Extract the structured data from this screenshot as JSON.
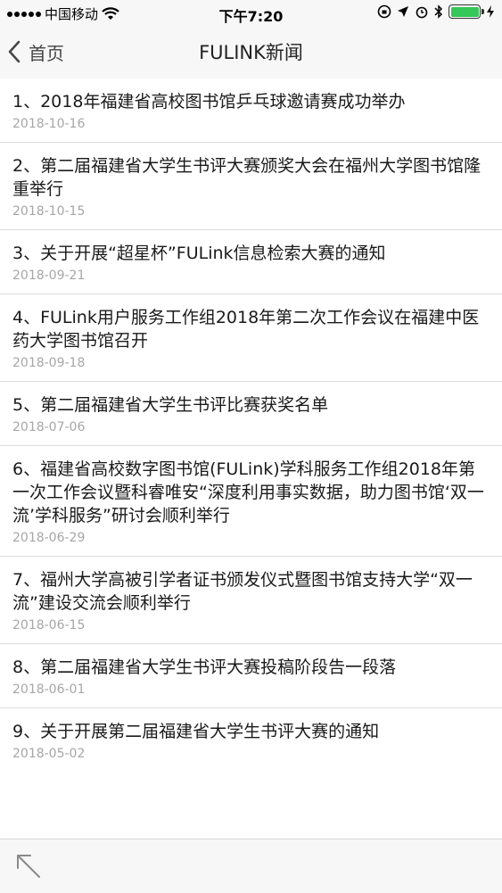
{
  "status_bar": {
    "carrier": "中国移动",
    "time": "下午7:20",
    "battery_color": "#35c759"
  },
  "nav": {
    "back_label": "首页",
    "title": "FULINK新闻"
  },
  "news": [
    {
      "title": "1、2018年福建省高校图书馆乒乓球邀请赛成功举办",
      "date": "2018-10-16"
    },
    {
      "title": "2、第二届福建省大学生书评大赛颁奖大会在福州大学图书馆隆重举行",
      "date": "2018-10-15"
    },
    {
      "title": "3、关于开展“超星杯”FULink信息检索大赛的通知",
      "date": "2018-09-21"
    },
    {
      "title": "4、FULink用户服务工作组2018年第二次工作会议在福建中医药大学图书馆召开",
      "date": "2018-09-18"
    },
    {
      "title": "5、第二届福建省大学生书评比赛获奖名单",
      "date": "2018-07-06"
    },
    {
      "title": "6、福建省高校数字图书馆(FULink)学科服务工作组2018年第一次工作会议暨科睿唯安“深度利用事实数据，助力图书馆‘双一流’学科服务”研讨会顺利举行",
      "date": "2018-06-29"
    },
    {
      "title": "7、福州大学高被引学者证书颁发仪式暨图书馆支持大学“双一流”建设交流会顺利举行",
      "date": "2018-06-15"
    },
    {
      "title": "8、第二届福建省大学生书评大赛投稿阶段告一段落",
      "date": "2018-06-01"
    },
    {
      "title": "9、关于开展第二届福建省大学生书评大赛的通知",
      "date": "2018-05-02"
    }
  ]
}
